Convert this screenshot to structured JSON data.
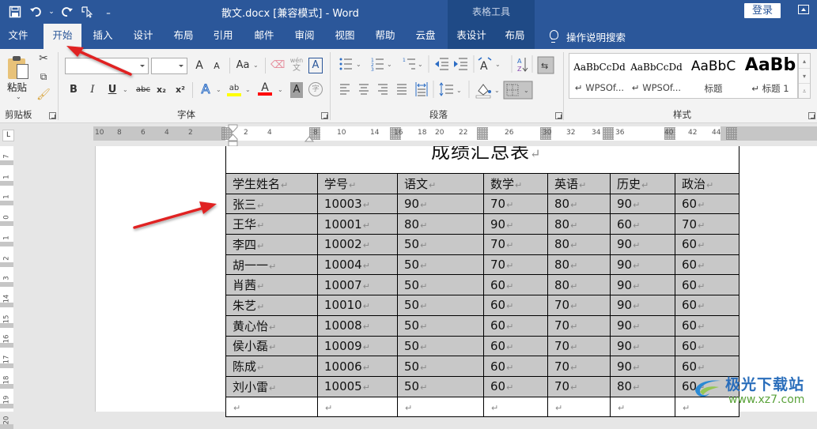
{
  "titlebar": {
    "document_title": "散文.docx [兼容模式]  -  Word",
    "context_tab_group": "表格工具",
    "login_label": "登录",
    "qat_icons": [
      "save-icon",
      "undo-icon",
      "redo-icon",
      "touch-mode-icon",
      "customize-qat-icon"
    ]
  },
  "tabs": [
    {
      "label": "文件"
    },
    {
      "label": "开始",
      "active": true
    },
    {
      "label": "插入"
    },
    {
      "label": "设计"
    },
    {
      "label": "布局"
    },
    {
      "label": "引用"
    },
    {
      "label": "邮件"
    },
    {
      "label": "审阅"
    },
    {
      "label": "视图"
    },
    {
      "label": "帮助"
    },
    {
      "label": "云盘"
    },
    {
      "label": "表设计"
    },
    {
      "label": "布局"
    }
  ],
  "tell_me": "操作说明搜索",
  "ribbon": {
    "clipboard": {
      "group_label": "剪贴板",
      "paste_label": "粘贴"
    },
    "font": {
      "group_label": "字体",
      "font_name": "",
      "font_size": "",
      "grow_font": "A",
      "shrink_font": "A",
      "change_case": "Aa",
      "bold": "B",
      "italic": "I",
      "underline": "U",
      "strikethrough": "abc",
      "subscript": "x₂",
      "superscript": "x²",
      "text_effects": "A",
      "font_color": "A",
      "char_shading": "A",
      "enclose_char": "字",
      "phonetic": "wén",
      "char_border": "A",
      "highlight_color": "#ffff00",
      "font_color_value": "#ff0000"
    },
    "paragraph": {
      "group_label": "段落"
    },
    "styles": {
      "group_label": "样式",
      "items": [
        {
          "preview": "AaBbCcDd",
          "name": "↵ WPSOf..."
        },
        {
          "preview": "AaBbCcDd",
          "name": "↵ WPSOf..."
        },
        {
          "preview": "AaBbC",
          "name": "标题"
        },
        {
          "preview": "AaBb",
          "name": "↵ 标题 1"
        }
      ]
    }
  },
  "ruler": {
    "horizontal_numbers": [
      "10",
      "8",
      "6",
      "4",
      "2",
      "2",
      "4",
      "8",
      "10",
      "14",
      "16",
      "18",
      "20",
      "22",
      "26",
      "30",
      "32",
      "34",
      "36",
      "40",
      "42",
      "44"
    ],
    "vertical_numbers": [
      "7",
      "1",
      "1",
      "0",
      "1",
      "2",
      "3",
      "14",
      "15",
      "16",
      "17",
      "18",
      "19",
      "20"
    ]
  },
  "document": {
    "title": "成绩汇总表",
    "table": {
      "headers": [
        "学生姓名",
        "学号",
        "语文",
        "数学",
        "英语",
        "历史",
        "政治"
      ],
      "rows": [
        [
          "张三",
          "10003",
          "90",
          "70",
          "80",
          "90",
          "60"
        ],
        [
          "王华",
          "10001",
          "80",
          "90",
          "80",
          "60",
          "70"
        ],
        [
          "李四",
          "10002",
          "50",
          "70",
          "80",
          "90",
          "60"
        ],
        [
          "胡一一",
          "10004",
          "50",
          "70",
          "80",
          "90",
          "60"
        ],
        [
          "肖茜",
          "10007",
          "50",
          "60",
          "80",
          "90",
          "60"
        ],
        [
          "朱艺",
          "10010",
          "50",
          "60",
          "70",
          "90",
          "60"
        ],
        [
          "黄心怡",
          "10008",
          "50",
          "60",
          "70",
          "90",
          "60"
        ],
        [
          "侯小磊",
          "10009",
          "50",
          "60",
          "70",
          "90",
          "60"
        ],
        [
          "陈成",
          "10006",
          "50",
          "60",
          "70",
          "90",
          "60"
        ],
        [
          "刘小雷",
          "10005",
          "50",
          "60",
          "70",
          "80",
          "60"
        ]
      ],
      "empty_row": [
        "",
        "",
        "",
        "",
        "",
        "",
        ""
      ],
      "paragraph_mark": "↵",
      "shading_color": "#c8c8c8"
    }
  },
  "watermark": {
    "title": "极光下载站",
    "url": "www.xz7.com"
  },
  "colors": {
    "brand": "#2b579a",
    "context_tab": "#1f4a86",
    "annotation_arrow": "#e02020"
  }
}
